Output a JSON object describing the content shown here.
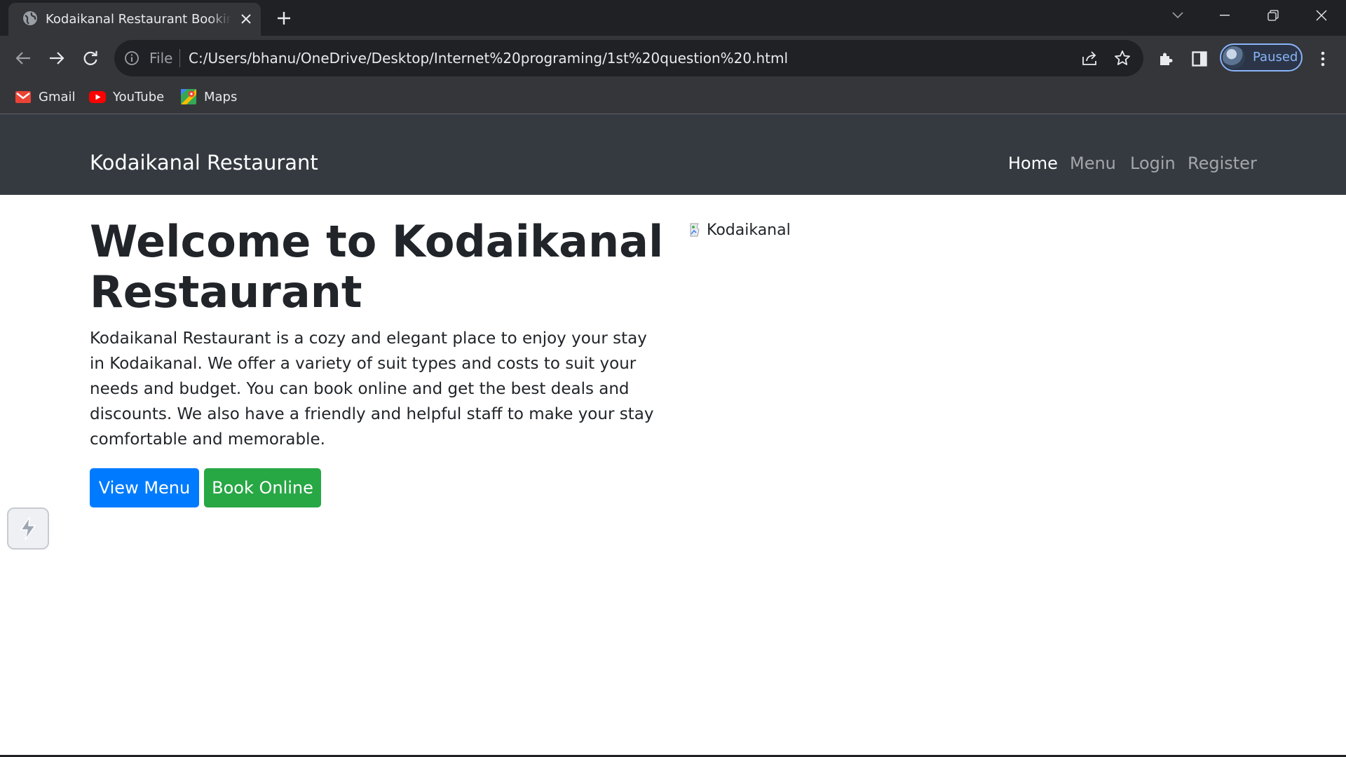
{
  "browser": {
    "tab": {
      "title": "Kodaikanal Restaurant Booking System",
      "favicon": "globe-icon"
    },
    "address_bar": {
      "scheme_label": "File",
      "url": "C:/Users/bhanu/OneDrive/Desktop/Internet%20programing/1st%20question%20.html"
    },
    "profile": {
      "status": "Paused"
    },
    "bookmarks": [
      {
        "label": "Gmail",
        "icon": "gmail-icon"
      },
      {
        "label": "YouTube",
        "icon": "youtube-icon"
      },
      {
        "label": "Maps",
        "icon": "maps-icon"
      }
    ],
    "colors": {
      "frame": "#202124",
      "toolbar": "#35363a",
      "accent": "#8ab4f8"
    }
  },
  "site": {
    "brand": "Kodaikanal Restaurant",
    "nav": [
      {
        "label": "Home",
        "active": true
      },
      {
        "label": "Menu",
        "active": false
      },
      {
        "label": "Login",
        "active": false
      },
      {
        "label": "Register",
        "active": false
      }
    ],
    "hero": {
      "title": "Welcome to Kodaikanal Restaurant",
      "description": "Kodaikanal Restaurant is a cozy and elegant place to enjoy your stay in Kodaikanal. We offer a variety of suit types and costs to suit your needs and budget. You can book online and get the best deals and discounts. We also have a friendly and helpful staff to make your stay comfortable and memorable.",
      "primary_button": "View Menu",
      "secondary_button": "Book Online",
      "image_alt": "Kodaikanal"
    },
    "colors": {
      "navbar": "#343a40",
      "primary": "#007bff",
      "success": "#28a745",
      "text": "#212529"
    }
  }
}
